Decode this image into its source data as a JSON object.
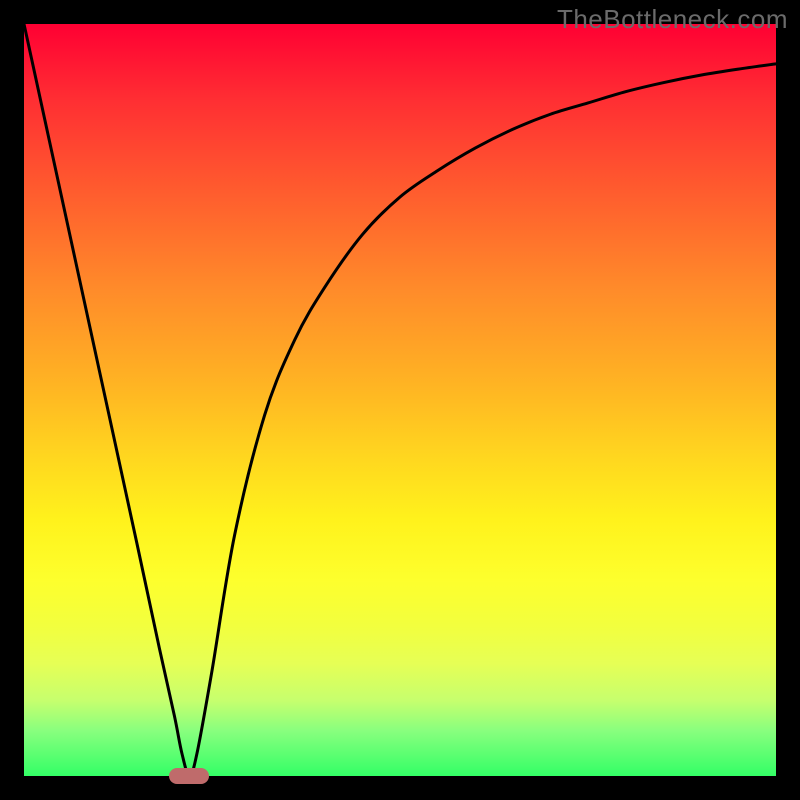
{
  "watermark": "TheBottleneck.com",
  "chart_data": {
    "type": "line",
    "title": "",
    "xlabel": "",
    "ylabel": "",
    "x_range": [
      0,
      100
    ],
    "y_range": [
      0,
      100
    ],
    "series": [
      {
        "name": "bottleneck-curve",
        "x": [
          0,
          5,
          10,
          15,
          18,
          20,
          21,
          22,
          23,
          25,
          28,
          32,
          36,
          40,
          45,
          50,
          55,
          60,
          65,
          70,
          75,
          80,
          85,
          90,
          95,
          100
        ],
        "y": [
          100,
          77,
          54,
          31,
          17,
          8,
          3,
          0,
          3,
          14,
          32,
          48,
          58,
          65,
          72,
          77,
          80.5,
          83.5,
          86,
          88,
          89.5,
          91,
          92.2,
          93.2,
          94,
          94.7
        ]
      }
    ],
    "marker": {
      "x": 22,
      "y": 0
    },
    "background_gradient": {
      "top": "#ff0033",
      "bottom": "#33ff66"
    }
  }
}
